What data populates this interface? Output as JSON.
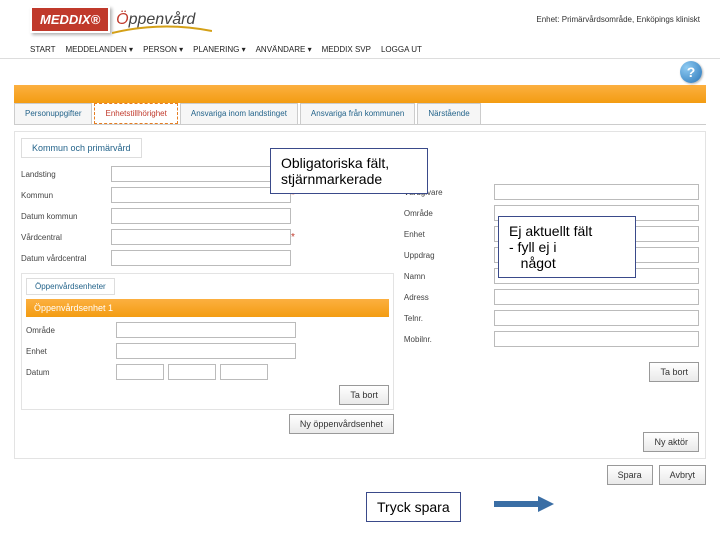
{
  "header": {
    "brand_main": "MEDDIX",
    "brand_reg": "®",
    "brand_sub_prefix": "Ö",
    "brand_sub_rest": "ppenvård",
    "user_line": "Enhet: Primärvårdsområde, Enköpings kliniskt"
  },
  "menu": {
    "items": [
      "START",
      "MEDDELANDEN ▾",
      "PERSON ▾",
      "PLANERING ▾",
      "ANVÄNDARE ▾",
      "MEDDIX SVP",
      "LOGGA UT"
    ]
  },
  "tabs": {
    "items": [
      "Personuppgifter",
      "Enhetstillhörighet",
      "Ansvariga inom landstinget",
      "Ansvariga från kommunen",
      "Närstående"
    ]
  },
  "section1": {
    "title": "Kommun och primärvård",
    "labels": {
      "landsting": "Landsting",
      "kommun": "Kommun",
      "datum_kommun": "Datum kommun",
      "vardcentral": "Vårdcentral",
      "datum_vardcentral": "Datum vårdcentral"
    }
  },
  "rightcol": {
    "labels": {
      "vardgivare": "Vårdgivare",
      "omrade": "Område",
      "enhet": "Enhet",
      "uppdrag": "Uppdrag",
      "namn": "Namn",
      "adress": "Adress",
      "telnr": "Telnr.",
      "mobilnr": "Mobilnr."
    }
  },
  "openvard": {
    "section": "Öppenvårdsenheter",
    "header": "Öppenvårdsenhet 1",
    "labels": {
      "omrade": "Område",
      "enhet": "Enhet",
      "datum": "Datum"
    }
  },
  "buttons": {
    "tabort": "Ta bort",
    "nyenhet": "Ny öppenvårdsenhet",
    "nyaktor": "Ny aktör",
    "spara": "Spara",
    "avbryt": "Avbryt"
  },
  "annotations": {
    "mandatory": "Obligatoriska fält, stjärnmarkerade",
    "not_current_l1": "Ej aktuellt fält",
    "not_current_l2": "-  fyll ej i",
    "not_current_l3": "   något",
    "tryck_spara": "Tryck spara"
  },
  "help": {
    "glyph": "?"
  }
}
